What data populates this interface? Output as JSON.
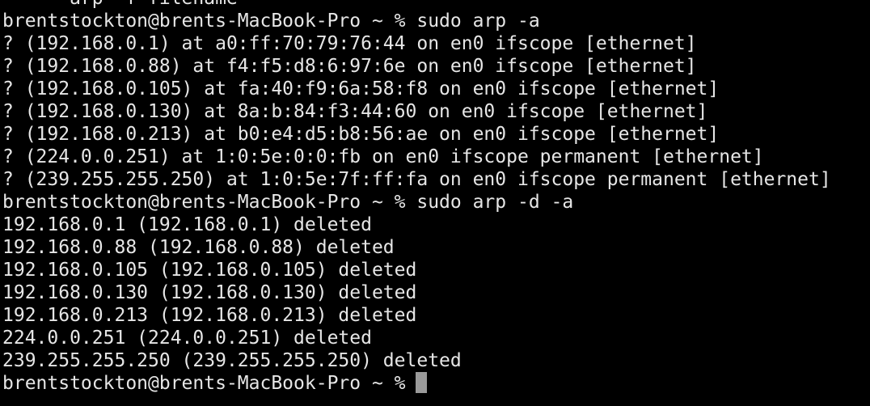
{
  "terminal": {
    "lines": [
      "      arp -f filename",
      "brentstockton@brents-MacBook-Pro ~ % sudo arp -a",
      "? (192.168.0.1) at a0:ff:70:79:76:44 on en0 ifscope [ethernet]",
      "? (192.168.0.88) at f4:f5:d8:6:97:6e on en0 ifscope [ethernet]",
      "? (192.168.0.105) at fa:40:f9:6a:58:f8 on en0 ifscope [ethernet]",
      "? (192.168.0.130) at 8a:b:84:f3:44:60 on en0 ifscope [ethernet]",
      "? (192.168.0.213) at b0:e4:d5:b8:56:ae on en0 ifscope [ethernet]",
      "? (224.0.0.251) at 1:0:5e:0:0:fb on en0 ifscope permanent [ethernet]",
      "? (239.255.255.250) at 1:0:5e:7f:ff:fa on en0 ifscope permanent [ethernet]",
      "brentstockton@brents-MacBook-Pro ~ % sudo arp -d -a",
      "192.168.0.1 (192.168.0.1) deleted",
      "192.168.0.88 (192.168.0.88) deleted",
      "192.168.0.105 (192.168.0.105) deleted",
      "192.168.0.130 (192.168.0.130) deleted",
      "192.168.0.213 (192.168.0.213) deleted",
      "224.0.0.251 (224.0.0.251) deleted",
      "239.255.255.250 (239.255.255.250) deleted"
    ],
    "prompt": "brentstockton@brents-MacBook-Pro ~ %",
    "text_color": "#e6e6e6",
    "background_color": "#000000",
    "cursor_color": "#9a9a9a"
  }
}
